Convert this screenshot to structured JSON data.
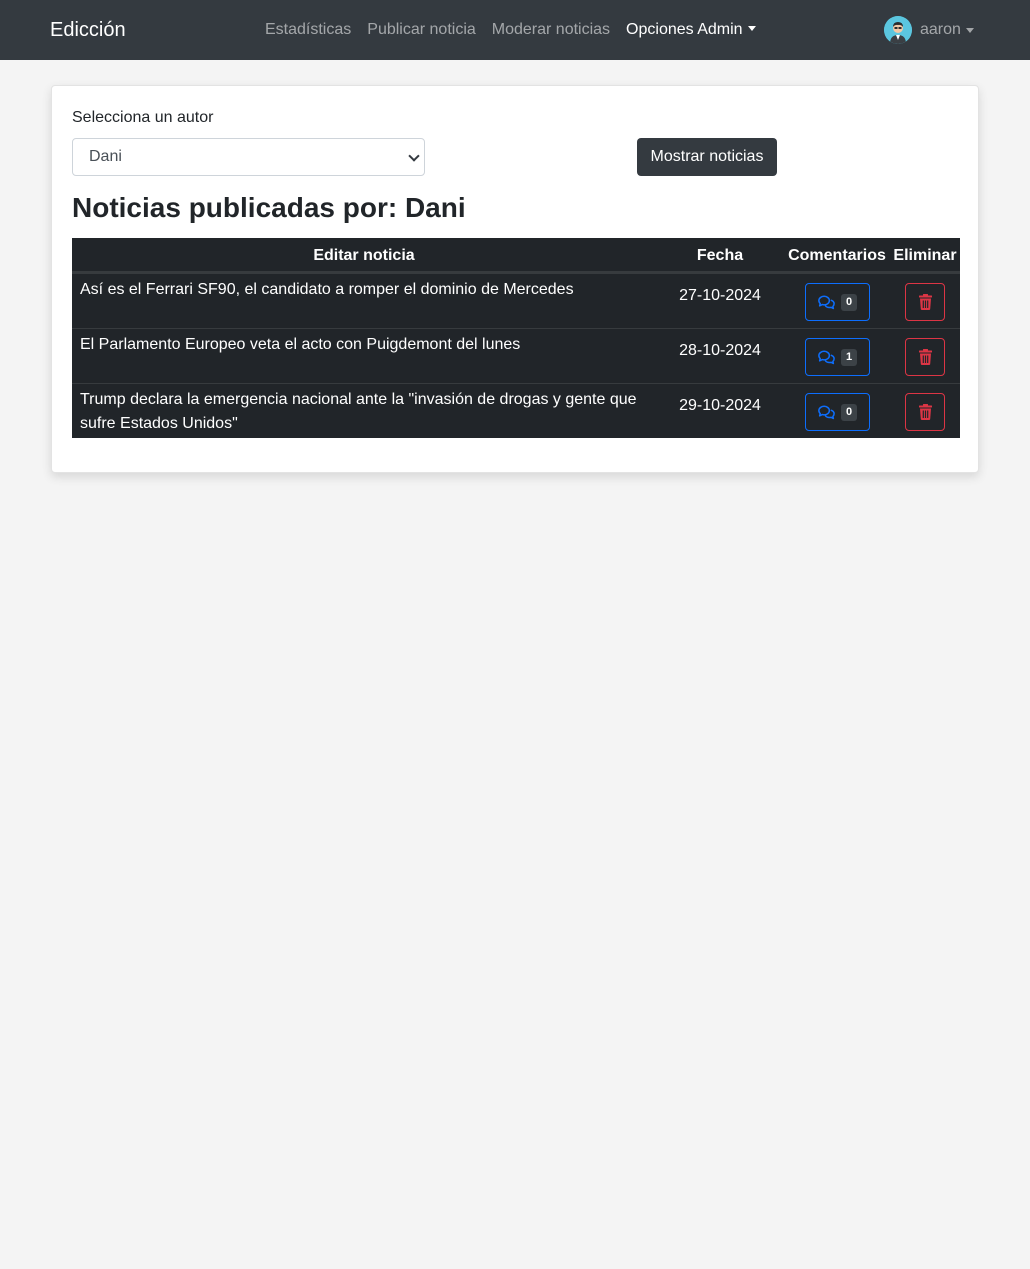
{
  "navbar": {
    "brand": "Edicción",
    "links": [
      {
        "label": "Estadísticas"
      },
      {
        "label": "Publicar noticia"
      },
      {
        "label": "Moderar noticias"
      },
      {
        "label": "Opciones Admin"
      }
    ],
    "user": {
      "name": "aaron",
      "avatar_icon": "user-avatar-icon"
    }
  },
  "filter": {
    "label": "Selecciona un autor",
    "selected_author": "Dani",
    "button_label": "Mostrar noticias"
  },
  "heading": "Noticias publicadas por: Dani",
  "table": {
    "headers": {
      "title": "Editar noticia",
      "date": "Fecha",
      "comments": "Comentarios",
      "delete": "Eliminar"
    },
    "rows": [
      {
        "title": "Así es el Ferrari SF90, el candidato a romper el dominio de Mercedes",
        "date": "27-10-2024",
        "comments": "0"
      },
      {
        "title": "El Parlamento Europeo veta el acto con Puigdemont del lunes",
        "date": "28-10-2024",
        "comments": "1"
      },
      {
        "title": "Trump declara la emergencia nacional ante la \"invasión de drogas y gente que sufre Estados Unidos\"",
        "date": "29-10-2024",
        "comments": "0"
      }
    ]
  },
  "colors": {
    "navbar": "#343a40",
    "table_bg": "#212529",
    "comments_accent": "#0d6efd",
    "delete_accent": "#dc3545",
    "page_bg": "#f4f4f4"
  },
  "icons": {
    "comments": "comments-icon",
    "delete": "trash-icon",
    "dropdown": "caret-down-icon"
  }
}
